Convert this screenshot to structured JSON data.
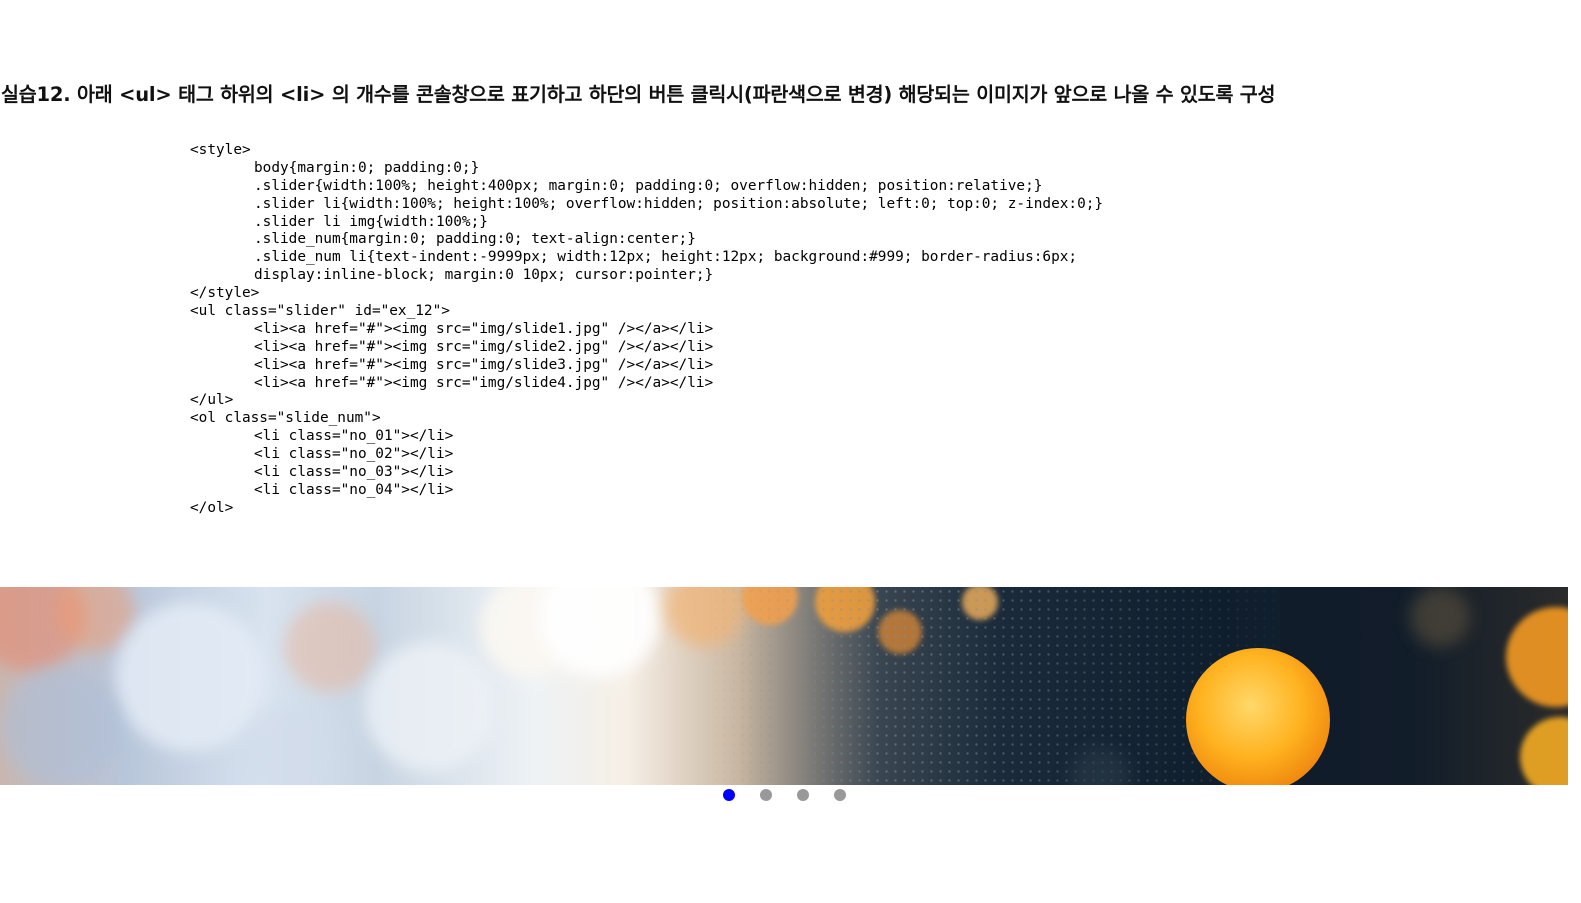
{
  "heading": "실습12. 아래 <ul> 태그 하위의 <li> 의 개수를 콘솔창으로 표기하고 하단의 버튼 클릭시(파란색으로 변경) 해당되는 이미지가 앞으로 나올 수 있도록 구성",
  "code": {
    "lines": [
      {
        "text": "<style>",
        "indent": false
      },
      {
        "text": "body{margin:0; padding:0;}",
        "indent": true
      },
      {
        "text": ".slider{width:100%; height:400px; margin:0; padding:0; overflow:hidden; position:relative;}",
        "indent": true
      },
      {
        "text": ".slider li{width:100%; height:100%; overflow:hidden; position:absolute; left:0; top:0; z-index:0;}",
        "indent": true
      },
      {
        "text": ".slider li img{width:100%;}",
        "indent": true
      },
      {
        "text": ".slide_num{margin:0; padding:0; text-align:center;}",
        "indent": true
      },
      {
        "text": ".slide_num li{text-indent:-9999px; width:12px; height:12px; background:#999; border-radius:6px;",
        "indent": true
      },
      {
        "text": "display:inline-block; margin:0 10px; cursor:pointer;}",
        "indent": true
      },
      {
        "text": "</style>",
        "indent": false
      },
      {
        "text": "<ul class=\"slider\" id=\"ex_12\">",
        "indent": false
      },
      {
        "text": "<li><a href=\"#\"><img src=\"img/slide1.jpg\" /></a></li>",
        "indent": true
      },
      {
        "text": "<li><a href=\"#\"><img src=\"img/slide2.jpg\" /></a></li>",
        "indent": true
      },
      {
        "text": "<li><a href=\"#\"><img src=\"img/slide3.jpg\" /></a></li>",
        "indent": true
      },
      {
        "text": "<li><a href=\"#\"><img src=\"img/slide4.jpg\" /></a></li>",
        "indent": true
      },
      {
        "text": "</ul>",
        "indent": false
      },
      {
        "text": "<ol class=\"slide_num\">",
        "indent": false
      },
      {
        "text": "<li class=\"no_01\"></li>",
        "indent": true
      },
      {
        "text": "<li class=\"no_02\"></li>",
        "indent": true
      },
      {
        "text": "<li class=\"no_03\"></li>",
        "indent": true
      },
      {
        "text": "<li class=\"no_04\"></li>",
        "indent": true
      },
      {
        "text": "</ol>",
        "indent": false
      }
    ]
  },
  "slider": {
    "image_description": "bokeh city lights slide image",
    "active_slide": 1,
    "slide_count": 4
  },
  "slide_nav": {
    "dots": [
      {
        "name": "slide-dot-1",
        "active": true
      },
      {
        "name": "slide-dot-2",
        "active": false
      },
      {
        "name": "slide-dot-3",
        "active": false
      },
      {
        "name": "slide-dot-4",
        "active": false
      }
    ],
    "colors": {
      "active": "#0000ff",
      "inactive": "#999999"
    }
  }
}
